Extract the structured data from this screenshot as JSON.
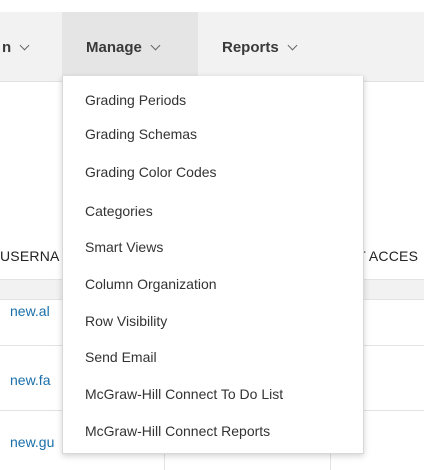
{
  "menubar": {
    "partial_label": "n",
    "manage_label": "Manage",
    "reports_label": "Reports"
  },
  "table": {
    "username_header": "USERNA",
    "last_access_header": "AST ACCES",
    "rows": [
      {
        "username": "new.al"
      },
      {
        "username": "new.fa"
      },
      {
        "username": "new.gu"
      }
    ]
  },
  "manage_menu": {
    "items": [
      "Grading Periods",
      "Grading Schemas",
      "Grading Color Codes",
      "Categories",
      "Smart Views",
      "Column Organization",
      "Row Visibility",
      "Send Email",
      "McGraw-Hill Connect To Do List",
      "McGraw-Hill Connect Reports"
    ]
  },
  "colors": {
    "menubar_bg": "#f2f2f2",
    "active_tab_bg": "#e5e5e5",
    "link": "#1a6fa8"
  }
}
